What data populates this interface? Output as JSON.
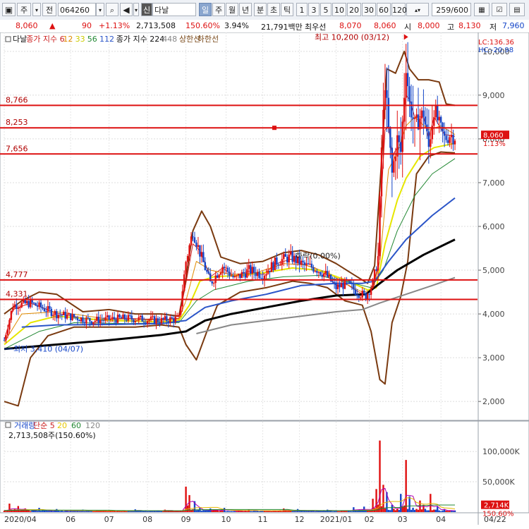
{
  "toolbar": {
    "menu_icon": "menu-icon",
    "type_btn": "주",
    "market_btn": "전",
    "code": "064260",
    "sound_icon": "speaker-icon",
    "search_icon": "search-icon",
    "new_btn": "신",
    "name": "다날",
    "periods": [
      "일",
      "주",
      "월",
      "년",
      "분",
      "초",
      "틱"
    ],
    "active_period": "일",
    "intervals": [
      "1",
      "3",
      "5",
      "10",
      "20",
      "30",
      "60",
      "120"
    ],
    "count": "259/600"
  },
  "quote": {
    "price": "8,060",
    "change_arrow": "▲",
    "change": "90",
    "change_pct": "+1.13%",
    "volume": "2,713,508",
    "volume_ratio": "150.60%",
    "turnover": "3.94%",
    "amount": "21,791백만",
    "best_bid_label": "최우선",
    "best_ask": "8,070",
    "best_bid": "8,060",
    "open_label": "시",
    "open": "8,000",
    "high_label": "고",
    "high": "8,130",
    "low_label": "저",
    "low": "7,960"
  },
  "chart_data": {
    "type": "line",
    "legend": [
      {
        "text": "다날",
        "color": "#111111"
      },
      {
        "text": "종가 지수 6",
        "color": "#cc2020"
      },
      {
        "text": "12",
        "color": "#e08a00"
      },
      {
        "text": "33",
        "color": "#cccc00"
      },
      {
        "text": "56",
        "color": "#228833"
      },
      {
        "text": "112",
        "color": "#2b55c8"
      },
      {
        "text": "종가 지수 224",
        "color": "#111111"
      },
      {
        "text": "448",
        "color": "#888888"
      },
      {
        "text": "상한선",
        "color": "#7a4a1a"
      },
      {
        "text": "하한선",
        "color": "#7a4a1a"
      }
    ],
    "price_axis": {
      "min": 1600,
      "max": 10400,
      "ticks": [
        "2,000",
        "3,000",
        "4,000",
        "5,000",
        "6,000",
        "7,000",
        "8,000",
        "9,000",
        "10,000"
      ],
      "tick_values": [
        2000,
        3000,
        4000,
        5000,
        6000,
        7000,
        8000,
        9000,
        10000
      ]
    },
    "corner_labels": {
      "lc": "LC:136.36",
      "hc": "HC:-20.98"
    },
    "last_price": "8,060",
    "last_pct": "1.13%",
    "horizontal_lines": [
      {
        "label": "8,766",
        "value": 8766
      },
      {
        "label": "8,253",
        "value": 8253
      },
      {
        "label": "7,656",
        "value": 7656
      },
      {
        "label": "4,777",
        "value": 4777
      },
      {
        "label": "4,331",
        "value": 4331
      }
    ],
    "annotations": {
      "high": "최고 10,200 (03/12)",
      "low": "최저 3,410 (04/07)",
      "drop": "하락(0.00%)"
    },
    "x_labels": [
      "2020/04",
      "06",
      "07",
      "08",
      "09",
      "10",
      "11",
      "12",
      "2021/01",
      "02",
      "03",
      "04",
      "04/22"
    ],
    "x_range": [
      0,
      258
    ],
    "x_label_days": [
      0,
      38,
      60,
      82,
      104,
      127,
      148,
      169,
      190,
      209,
      228,
      250,
      282
    ],
    "price_anchors": [
      [
        0,
        3400
      ],
      [
        5,
        4200
      ],
      [
        15,
        4250
      ],
      [
        30,
        4000
      ],
      [
        50,
        3850
      ],
      [
        70,
        3900
      ],
      [
        90,
        3850
      ],
      [
        100,
        3900
      ],
      [
        104,
        5200
      ],
      [
        108,
        5900
      ],
      [
        112,
        5400
      ],
      [
        118,
        4700
      ],
      [
        125,
        5100
      ],
      [
        132,
        4800
      ],
      [
        140,
        5000
      ],
      [
        148,
        4900
      ],
      [
        156,
        5200
      ],
      [
        164,
        5300
      ],
      [
        172,
        5100
      ],
      [
        178,
        5050
      ],
      [
        184,
        4900
      ],
      [
        190,
        4600
      ],
      [
        196,
        4700
      ],
      [
        202,
        4500
      ],
      [
        207,
        4400
      ],
      [
        211,
        4700
      ],
      [
        214,
        5300
      ],
      [
        216,
        7800
      ],
      [
        218,
        9300
      ],
      [
        220,
        8200
      ],
      [
        222,
        7200
      ],
      [
        225,
        8000
      ],
      [
        227,
        7700
      ],
      [
        230,
        9700
      ],
      [
        232,
        8800
      ],
      [
        235,
        8300
      ],
      [
        240,
        8600
      ],
      [
        243,
        7800
      ],
      [
        246,
        8700
      ],
      [
        249,
        8300
      ],
      [
        252,
        8000
      ],
      [
        255,
        8100
      ],
      [
        258,
        8060
      ]
    ],
    "ma_series": [
      {
        "name": "종가 지수 6",
        "color": "#cc2020",
        "width": 1,
        "values": [
          [
            0,
            3400
          ],
          [
            5,
            4100
          ],
          [
            15,
            4250
          ],
          [
            30,
            4020
          ],
          [
            50,
            3870
          ],
          [
            70,
            3900
          ],
          [
            90,
            3870
          ],
          [
            100,
            3900
          ],
          [
            104,
            4700
          ],
          [
            108,
            5600
          ],
          [
            112,
            5450
          ],
          [
            118,
            4850
          ],
          [
            125,
            5050
          ],
          [
            132,
            4850
          ],
          [
            140,
            4980
          ],
          [
            148,
            4900
          ],
          [
            156,
            5150
          ],
          [
            164,
            5250
          ],
          [
            172,
            5120
          ],
          [
            178,
            5050
          ],
          [
            184,
            4920
          ],
          [
            190,
            4650
          ],
          [
            196,
            4680
          ],
          [
            202,
            4520
          ],
          [
            207,
            4420
          ],
          [
            211,
            4620
          ],
          [
            214,
            5100
          ],
          [
            216,
            6800
          ],
          [
            218,
            8200
          ],
          [
            220,
            8300
          ],
          [
            222,
            7600
          ],
          [
            225,
            7800
          ],
          [
            227,
            7800
          ],
          [
            230,
            9000
          ],
          [
            232,
            8900
          ],
          [
            235,
            8500
          ],
          [
            240,
            8500
          ],
          [
            243,
            8000
          ],
          [
            246,
            8500
          ],
          [
            249,
            8300
          ],
          [
            252,
            8100
          ],
          [
            255,
            8080
          ],
          [
            258,
            8060
          ]
        ]
      },
      {
        "name": "12",
        "color": "#e08a00",
        "width": 1,
        "values": [
          [
            0,
            3350
          ],
          [
            10,
            4000
          ],
          [
            30,
            4050
          ],
          [
            60,
            3880
          ],
          [
            90,
            3860
          ],
          [
            100,
            3880
          ],
          [
            104,
            4300
          ],
          [
            110,
            5200
          ],
          [
            118,
            5000
          ],
          [
            130,
            4900
          ],
          [
            145,
            4950
          ],
          [
            160,
            5150
          ],
          [
            172,
            5120
          ],
          [
            185,
            4950
          ],
          [
            195,
            4700
          ],
          [
            205,
            4500
          ],
          [
            211,
            4550
          ],
          [
            215,
            5200
          ],
          [
            220,
            7300
          ],
          [
            225,
            7700
          ],
          [
            230,
            8300
          ],
          [
            235,
            8500
          ],
          [
            243,
            8200
          ],
          [
            250,
            8300
          ],
          [
            258,
            8100
          ]
        ]
      },
      {
        "name": "33",
        "color": "#e6e600",
        "width": 2,
        "values": [
          [
            0,
            3300
          ],
          [
            15,
            3800
          ],
          [
            30,
            3950
          ],
          [
            60,
            3850
          ],
          [
            90,
            3820
          ],
          [
            100,
            3850
          ],
          [
            106,
            4200
          ],
          [
            112,
            4750
          ],
          [
            120,
            4850
          ],
          [
            135,
            4880
          ],
          [
            150,
            4950
          ],
          [
            165,
            5050
          ],
          [
            180,
            5000
          ],
          [
            195,
            4780
          ],
          [
            208,
            4550
          ],
          [
            213,
            4600
          ],
          [
            218,
            5600
          ],
          [
            225,
            6600
          ],
          [
            230,
            7100
          ],
          [
            238,
            7600
          ],
          [
            246,
            7800
          ],
          [
            258,
            7900
          ]
        ]
      },
      {
        "name": "56",
        "color": "#228833",
        "width": 1,
        "values": [
          [
            0,
            3200
          ],
          [
            20,
            3600
          ],
          [
            40,
            3800
          ],
          [
            70,
            3780
          ],
          [
            100,
            3800
          ],
          [
            110,
            4300
          ],
          [
            120,
            4550
          ],
          [
            140,
            4750
          ],
          [
            160,
            4850
          ],
          [
            180,
            4880
          ],
          [
            200,
            4700
          ],
          [
            210,
            4600
          ],
          [
            217,
            5000
          ],
          [
            225,
            5900
          ],
          [
            235,
            6700
          ],
          [
            245,
            7200
          ],
          [
            258,
            7550
          ]
        ]
      },
      {
        "name": "112",
        "color": "#2b55c8",
        "width": 2,
        "values": [
          [
            10,
            3700
          ],
          [
            30,
            3750
          ],
          [
            60,
            3760
          ],
          [
            90,
            3780
          ],
          [
            104,
            3850
          ],
          [
            115,
            4150
          ],
          [
            130,
            4300
          ],
          [
            150,
            4450
          ],
          [
            170,
            4650
          ],
          [
            190,
            4700
          ],
          [
            205,
            4700
          ],
          [
            212,
            4750
          ],
          [
            220,
            5200
          ],
          [
            230,
            5700
          ],
          [
            245,
            6250
          ],
          [
            258,
            6650
          ]
        ]
      },
      {
        "name": "종가 지수 224",
        "color": "#000000",
        "width": 3,
        "values": [
          [
            0,
            3200
          ],
          [
            30,
            3300
          ],
          [
            60,
            3400
          ],
          [
            90,
            3520
          ],
          [
            104,
            3600
          ],
          [
            115,
            3850
          ],
          [
            130,
            4000
          ],
          [
            150,
            4150
          ],
          [
            170,
            4300
          ],
          [
            190,
            4420
          ],
          [
            207,
            4450
          ],
          [
            215,
            4700
          ],
          [
            225,
            5000
          ],
          [
            240,
            5350
          ],
          [
            258,
            5700
          ]
        ]
      },
      {
        "name": "448",
        "color": "#888888",
        "width": 2,
        "values": [
          [
            110,
            3550
          ],
          [
            130,
            3750
          ],
          [
            150,
            3850
          ],
          [
            170,
            3950
          ],
          [
            190,
            4050
          ],
          [
            205,
            4100
          ],
          [
            215,
            4250
          ],
          [
            230,
            4450
          ],
          [
            245,
            4650
          ],
          [
            258,
            4830
          ]
        ]
      }
    ],
    "bollinger_upper": [
      [
        0,
        4000
      ],
      [
        10,
        4300
      ],
      [
        20,
        4500
      ],
      [
        30,
        4450
      ],
      [
        45,
        4050
      ],
      [
        60,
        4100
      ],
      [
        75,
        4000
      ],
      [
        90,
        4000
      ],
      [
        100,
        3950
      ],
      [
        104,
        4800
      ],
      [
        108,
        5900
      ],
      [
        113,
        6350
      ],
      [
        118,
        6000
      ],
      [
        124,
        5300
      ],
      [
        135,
        5150
      ],
      [
        148,
        5200
      ],
      [
        160,
        5400
      ],
      [
        170,
        5450
      ],
      [
        180,
        5350
      ],
      [
        190,
        5150
      ],
      [
        200,
        4900
      ],
      [
        208,
        4700
      ],
      [
        212,
        5100
      ],
      [
        216,
        7500
      ],
      [
        219,
        9600
      ],
      [
        224,
        9500
      ],
      [
        229,
        10000
      ],
      [
        232,
        9600
      ],
      [
        237,
        9350
      ],
      [
        243,
        9350
      ],
      [
        249,
        9300
      ],
      [
        253,
        8800
      ],
      [
        258,
        8766
      ]
    ],
    "bollinger_lower": [
      [
        0,
        2000
      ],
      [
        8,
        1900
      ],
      [
        15,
        3000
      ],
      [
        25,
        3500
      ],
      [
        40,
        3700
      ],
      [
        60,
        3700
      ],
      [
        75,
        3700
      ],
      [
        90,
        3750
      ],
      [
        100,
        3700
      ],
      [
        104,
        3300
      ],
      [
        110,
        2950
      ],
      [
        116,
        3600
      ],
      [
        122,
        4200
      ],
      [
        135,
        4500
      ],
      [
        150,
        4600
      ],
      [
        165,
        4750
      ],
      [
        175,
        4700
      ],
      [
        185,
        4600
      ],
      [
        195,
        4300
      ],
      [
        205,
        4200
      ],
      [
        210,
        3600
      ],
      [
        215,
        2500
      ],
      [
        218,
        2400
      ],
      [
        222,
        3800
      ],
      [
        227,
        4400
      ],
      [
        231,
        5200
      ],
      [
        236,
        7200
      ],
      [
        243,
        7600
      ],
      [
        250,
        7700
      ],
      [
        258,
        7680
      ]
    ],
    "volume": {
      "legend": [
        {
          "text": "거래량",
          "color": "#1546c8"
        },
        {
          "text": "단순 5",
          "color": "#cc2020"
        },
        {
          "text": "20",
          "color": "#e6c800"
        },
        {
          "text": "60",
          "color": "#228833"
        },
        {
          "text": "120",
          "color": "#888888"
        }
      ],
      "value_label": "2,713,508주(150.60%)",
      "axis": {
        "max": 128000,
        "ticks": [
          "50,000K",
          "100,000K"
        ],
        "tick_values": [
          50000,
          100000
        ]
      },
      "last_label": "2,714K",
      "last_pct": "150.60%",
      "spikes": [
        [
          3,
          14000
        ],
        [
          8,
          10000
        ],
        [
          12,
          6000
        ],
        [
          20,
          7000
        ],
        [
          30,
          5000
        ],
        [
          45,
          4000
        ],
        [
          60,
          3500
        ],
        [
          75,
          4500
        ],
        [
          92,
          4000
        ],
        [
          104,
          42000
        ],
        [
          106,
          28000
        ],
        [
          109,
          18000
        ],
        [
          112,
          8000
        ],
        [
          118,
          6000
        ],
        [
          126,
          7000
        ],
        [
          140,
          4000
        ],
        [
          160,
          6000
        ],
        [
          168,
          5000
        ],
        [
          185,
          4000
        ],
        [
          200,
          8000
        ],
        [
          206,
          9000
        ],
        [
          211,
          22000
        ],
        [
          213,
          38000
        ],
        [
          215,
          118000
        ],
        [
          217,
          45000
        ],
        [
          219,
          33000
        ],
        [
          222,
          12000
        ],
        [
          227,
          30000
        ],
        [
          230,
          86000
        ],
        [
          232,
          26000
        ],
        [
          238,
          19000
        ],
        [
          240,
          12000
        ],
        [
          244,
          30000
        ],
        [
          248,
          9000
        ],
        [
          252,
          5000
        ],
        [
          258,
          2714
        ]
      ]
    }
  }
}
